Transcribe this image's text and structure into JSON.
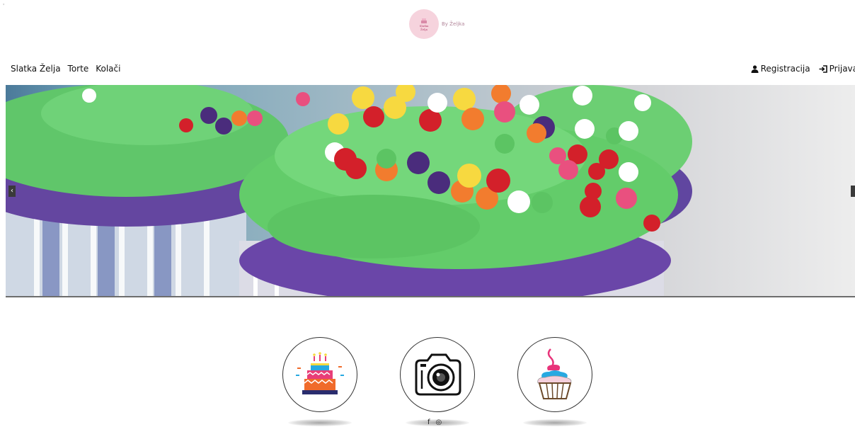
{
  "header": {
    "corner_mark": "'",
    "logo_small_line1": "Slatka",
    "logo_small_line2": "Želja",
    "logo_by": "By Željka"
  },
  "nav": {
    "brand": "Slatka Želja",
    "items": [
      "Torte",
      "Kolači"
    ],
    "register": "Registracija",
    "login": "Prijava"
  },
  "carousel": {
    "prev": "‹",
    "next": "›"
  },
  "categories": [
    "cake-icon",
    "camera-icon",
    "cupcake-icon"
  ],
  "social": {
    "facebook": "f",
    "instagram": "◎"
  },
  "colors": {
    "frosting": "#64c96a",
    "cupcake": "#6a4aa5",
    "logo_bg": "#f6d3dd"
  }
}
